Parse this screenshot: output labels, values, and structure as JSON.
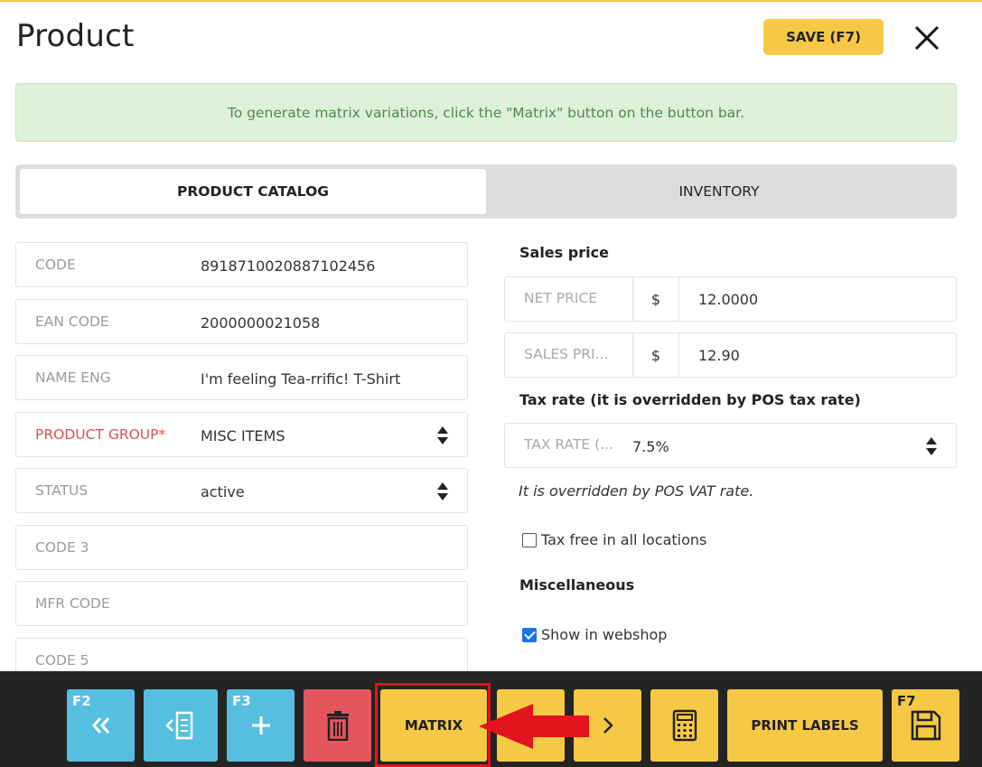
{
  "header": {
    "title": "Product",
    "save_label": "SAVE (F7)"
  },
  "info": {
    "message": "To generate matrix variations, click the \"Matrix\" button on the button bar."
  },
  "tabs": [
    {
      "label": "PRODUCT CATALOG"
    },
    {
      "label": "INVENTORY"
    }
  ],
  "fields": {
    "code": {
      "label": "CODE",
      "value": "8918710020887102456"
    },
    "ean": {
      "label": "EAN CODE",
      "value": "2000000021058"
    },
    "name_eng": {
      "label": "NAME ENG",
      "value": "I'm feeling Tea-rrific! T-Shirt"
    },
    "product_group": {
      "label": "PRODUCT GROUP*",
      "value": "MISC ITEMS"
    },
    "status": {
      "label": "STATUS",
      "value": "active"
    },
    "code3": {
      "label": "CODE 3",
      "value": ""
    },
    "mfr_code": {
      "label": "MFR CODE",
      "value": ""
    },
    "code5": {
      "label": "CODE 5",
      "value": ""
    }
  },
  "sales_price": {
    "title": "Sales price",
    "net_price": {
      "label": "NET PRICE",
      "currency": "$",
      "value": "12.0000"
    },
    "sales_price": {
      "label": "SALES PRI...",
      "currency": "$",
      "value": "12.90"
    }
  },
  "tax": {
    "title": "Tax rate (it is overridden by POS tax rate)",
    "label": "TAX RATE (...",
    "value": "7.5%",
    "note": "It is overridden by POS VAT rate.",
    "tax_free_label": "Tax free in all locations",
    "tax_free_checked": false
  },
  "misc": {
    "title": "Miscellaneous",
    "webshop_label": "Show in webshop",
    "webshop_checked": true
  },
  "button_bar": {
    "first_fkey": "F2",
    "new_fkey": "F3",
    "matrix_label": "MATRIX",
    "print_labels": "PRINT LABELS",
    "save_fkey": "F7"
  },
  "colors": {
    "accent_yellow": "#f6c945",
    "blue": "#56bfe0",
    "red": "#e4565d",
    "highlight": "#e3141b"
  }
}
